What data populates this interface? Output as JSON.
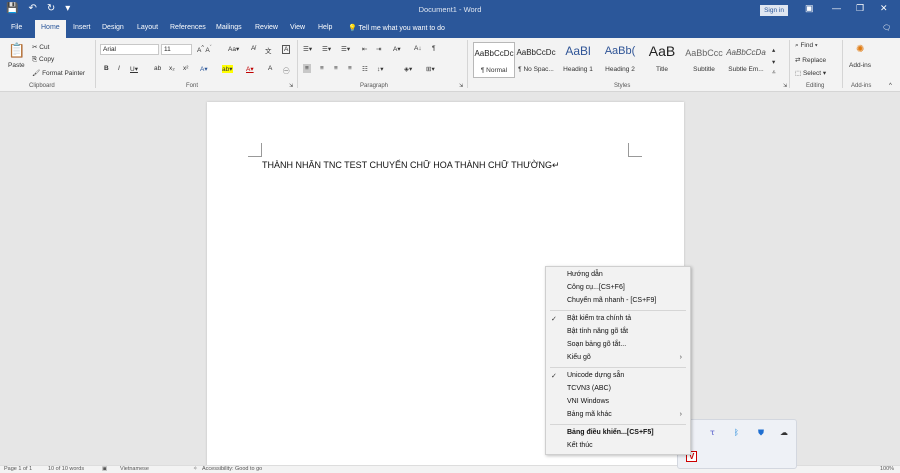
{
  "window": {
    "title": "Document1 - Word",
    "sign_in": "Sign in",
    "tell_me": "Tell me what you want to do"
  },
  "qat": {
    "save_icon": "save-icon",
    "undo_icon": "undo-icon",
    "redo_icon": "redo-icon",
    "more_icon": "chevron-down-icon"
  },
  "tabs": [
    "File",
    "Home",
    "Insert",
    "Design",
    "Layout",
    "References",
    "Mailings",
    "Review",
    "View",
    "Help"
  ],
  "ribbon": {
    "clipboard": {
      "label": "Clipboard",
      "paste": "Paste",
      "cut": "Cut",
      "copy": "Copy",
      "format_painter": "Format Painter"
    },
    "font": {
      "label": "Font",
      "name": "Arial",
      "size": "11"
    },
    "paragraph": {
      "label": "Paragraph"
    },
    "styles": {
      "label": "Styles",
      "items": [
        {
          "preview": "AaBbCcDc",
          "name": "¶ Normal"
        },
        {
          "preview": "AaBbCcDc",
          "name": "¶ No Spac..."
        },
        {
          "preview": "AaBl",
          "name": "Heading 1"
        },
        {
          "preview": "AaBb(",
          "name": "Heading 2"
        },
        {
          "preview": "AaB",
          "name": "Title"
        },
        {
          "preview": "AaBbCcc",
          "name": "Subtitle"
        },
        {
          "preview": "AaBbCcDa",
          "name": "Subtle Em..."
        }
      ]
    },
    "editing": {
      "label": "Editing",
      "find": "Find",
      "replace": "Replace",
      "select": "Select"
    },
    "addins": {
      "label": "Add-ins",
      "button": "Add-ins"
    }
  },
  "document": {
    "text": "THÀNH NHÂN TNC TEST CHUYỂN CHỮ HOA THÀNH CHỮ THƯỜNG↵"
  },
  "status": {
    "page": "Page 1 of 1",
    "words": "10 of 10 words",
    "language": "Vietnamese",
    "accessibility": "Accessibility: Good to go",
    "zoom": "100%"
  },
  "context_menu": {
    "items": [
      {
        "label": "Hướng dẫn"
      },
      {
        "label": "Công cụ...[CS+F6]"
      },
      {
        "label": "Chuyển mã nhanh - [CS+F9]"
      },
      {
        "label": "Bật kiểm tra chính tả",
        "checked": true
      },
      {
        "label": "Bật tính năng gõ tắt"
      },
      {
        "label": "Soạn bảng gõ tắt..."
      },
      {
        "label": "Kiểu gõ",
        "submenu": true
      },
      {
        "label": "Unicode dựng sẵn",
        "checked": true
      },
      {
        "label": "TCVN3 (ABC)"
      },
      {
        "label": "VNI Windows"
      },
      {
        "label": "Bảng mã khác",
        "submenu": true
      },
      {
        "label": "Bảng điều khiển...[CS+F5]",
        "bold": true
      },
      {
        "label": "Kết thúc"
      }
    ]
  },
  "tray": {
    "icons": [
      "teams-icon",
      "bluetooth-icon",
      "security-icon",
      "onedrive-icon",
      "unikey-icon"
    ]
  },
  "colors": {
    "accent": "#2b579a",
    "ribbon_bg": "#f3f3f3",
    "canvas_bg": "#e6e6e6"
  }
}
